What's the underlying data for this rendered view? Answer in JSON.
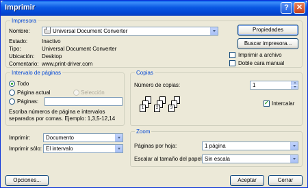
{
  "window": {
    "title": "Imprimir",
    "help_label": "?",
    "close_label": "✕"
  },
  "printer": {
    "legend": "Impresora",
    "name_label": "Nombre:",
    "name_value": "Universal Document Converter",
    "status_label": "Estado:",
    "status_value": "Inactivo",
    "type_label": "Tipo:",
    "type_value": "Universal Document Converter",
    "location_label": "Ubicación:",
    "location_value": "Desktop",
    "comment_label": "Comentario:",
    "comment_value": "www.print-driver.com",
    "properties_button": "Propiedades",
    "find_button": "Buscar impresora...",
    "print_to_file_label": "Imprimir a archivo",
    "duplex_label": "Doble cara manual"
  },
  "page_range": {
    "legend": "Intervalo de páginas",
    "all_label": "Todo",
    "current_label": "Página actual",
    "selection_label": "Selección",
    "pages_label": "Páginas:",
    "pages_value": "",
    "hint": "Escriba números de página e intervalos separados por comas. Ejemplo: 1,3,5-12,14"
  },
  "copies": {
    "legend": "Copias",
    "count_label": "Número de copias:",
    "count_value": "1",
    "collate_label": "Intercalar",
    "collate_checked": true
  },
  "print_options": {
    "print_label": "Imprimir:",
    "print_value": "Documento",
    "print_only_label": "Imprimir sólo:",
    "print_only_value": "El intervalo"
  },
  "zoom": {
    "legend": "Zoom",
    "pages_per_sheet_label": "Páginas por hoja:",
    "pages_per_sheet_value": "1 página",
    "scale_label": "Escalar al tamaño del papel:",
    "scale_value": "Sin escala"
  },
  "footer": {
    "options_button": "Opciones...",
    "ok_button": "Aceptar",
    "cancel_button": "Cerrar"
  },
  "collate_pages": [
    "1",
    "2",
    "3"
  ]
}
